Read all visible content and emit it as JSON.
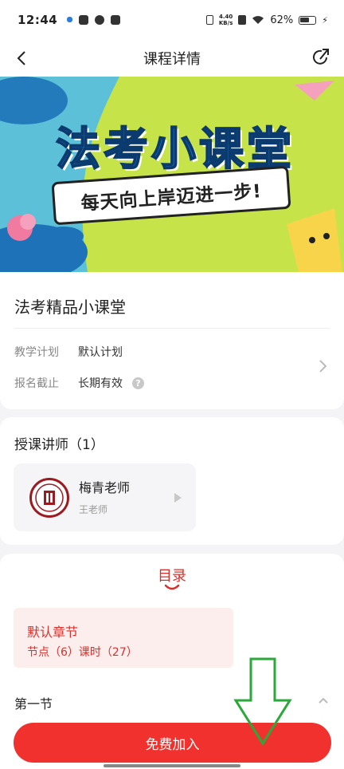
{
  "status_bar": {
    "time": "12:44",
    "net_speed_value": "4.40",
    "net_speed_unit": "KB/s",
    "battery": "62%"
  },
  "nav": {
    "title": "课程详情",
    "back_icon": "chevron-left-icon",
    "share_icon": "share-icon"
  },
  "banner": {
    "title": "法考小课堂",
    "slogan": "每天向上岸迈进一步!",
    "colors": {
      "left": "#5bc0d8",
      "right": "#c7e34a",
      "title": "#1f6fb8"
    }
  },
  "course": {
    "name": "法考精品小课堂",
    "fields": [
      {
        "label": "教学计划",
        "value": "默认计划"
      },
      {
        "label": "报名截止",
        "value": "长期有效"
      }
    ],
    "help_glyph": "?"
  },
  "teachers": {
    "title": "授课讲师（1）",
    "items": [
      {
        "name": "梅青老师",
        "subtitle": "王老师"
      }
    ]
  },
  "catalog": {
    "tab": "目录",
    "chapter": {
      "title": "默认章节",
      "meta": "节点（6）课时（27）"
    },
    "section": "第一节"
  },
  "cta": {
    "label": "免费加入",
    "color": "#f0312d"
  },
  "accent": "#d9302b"
}
